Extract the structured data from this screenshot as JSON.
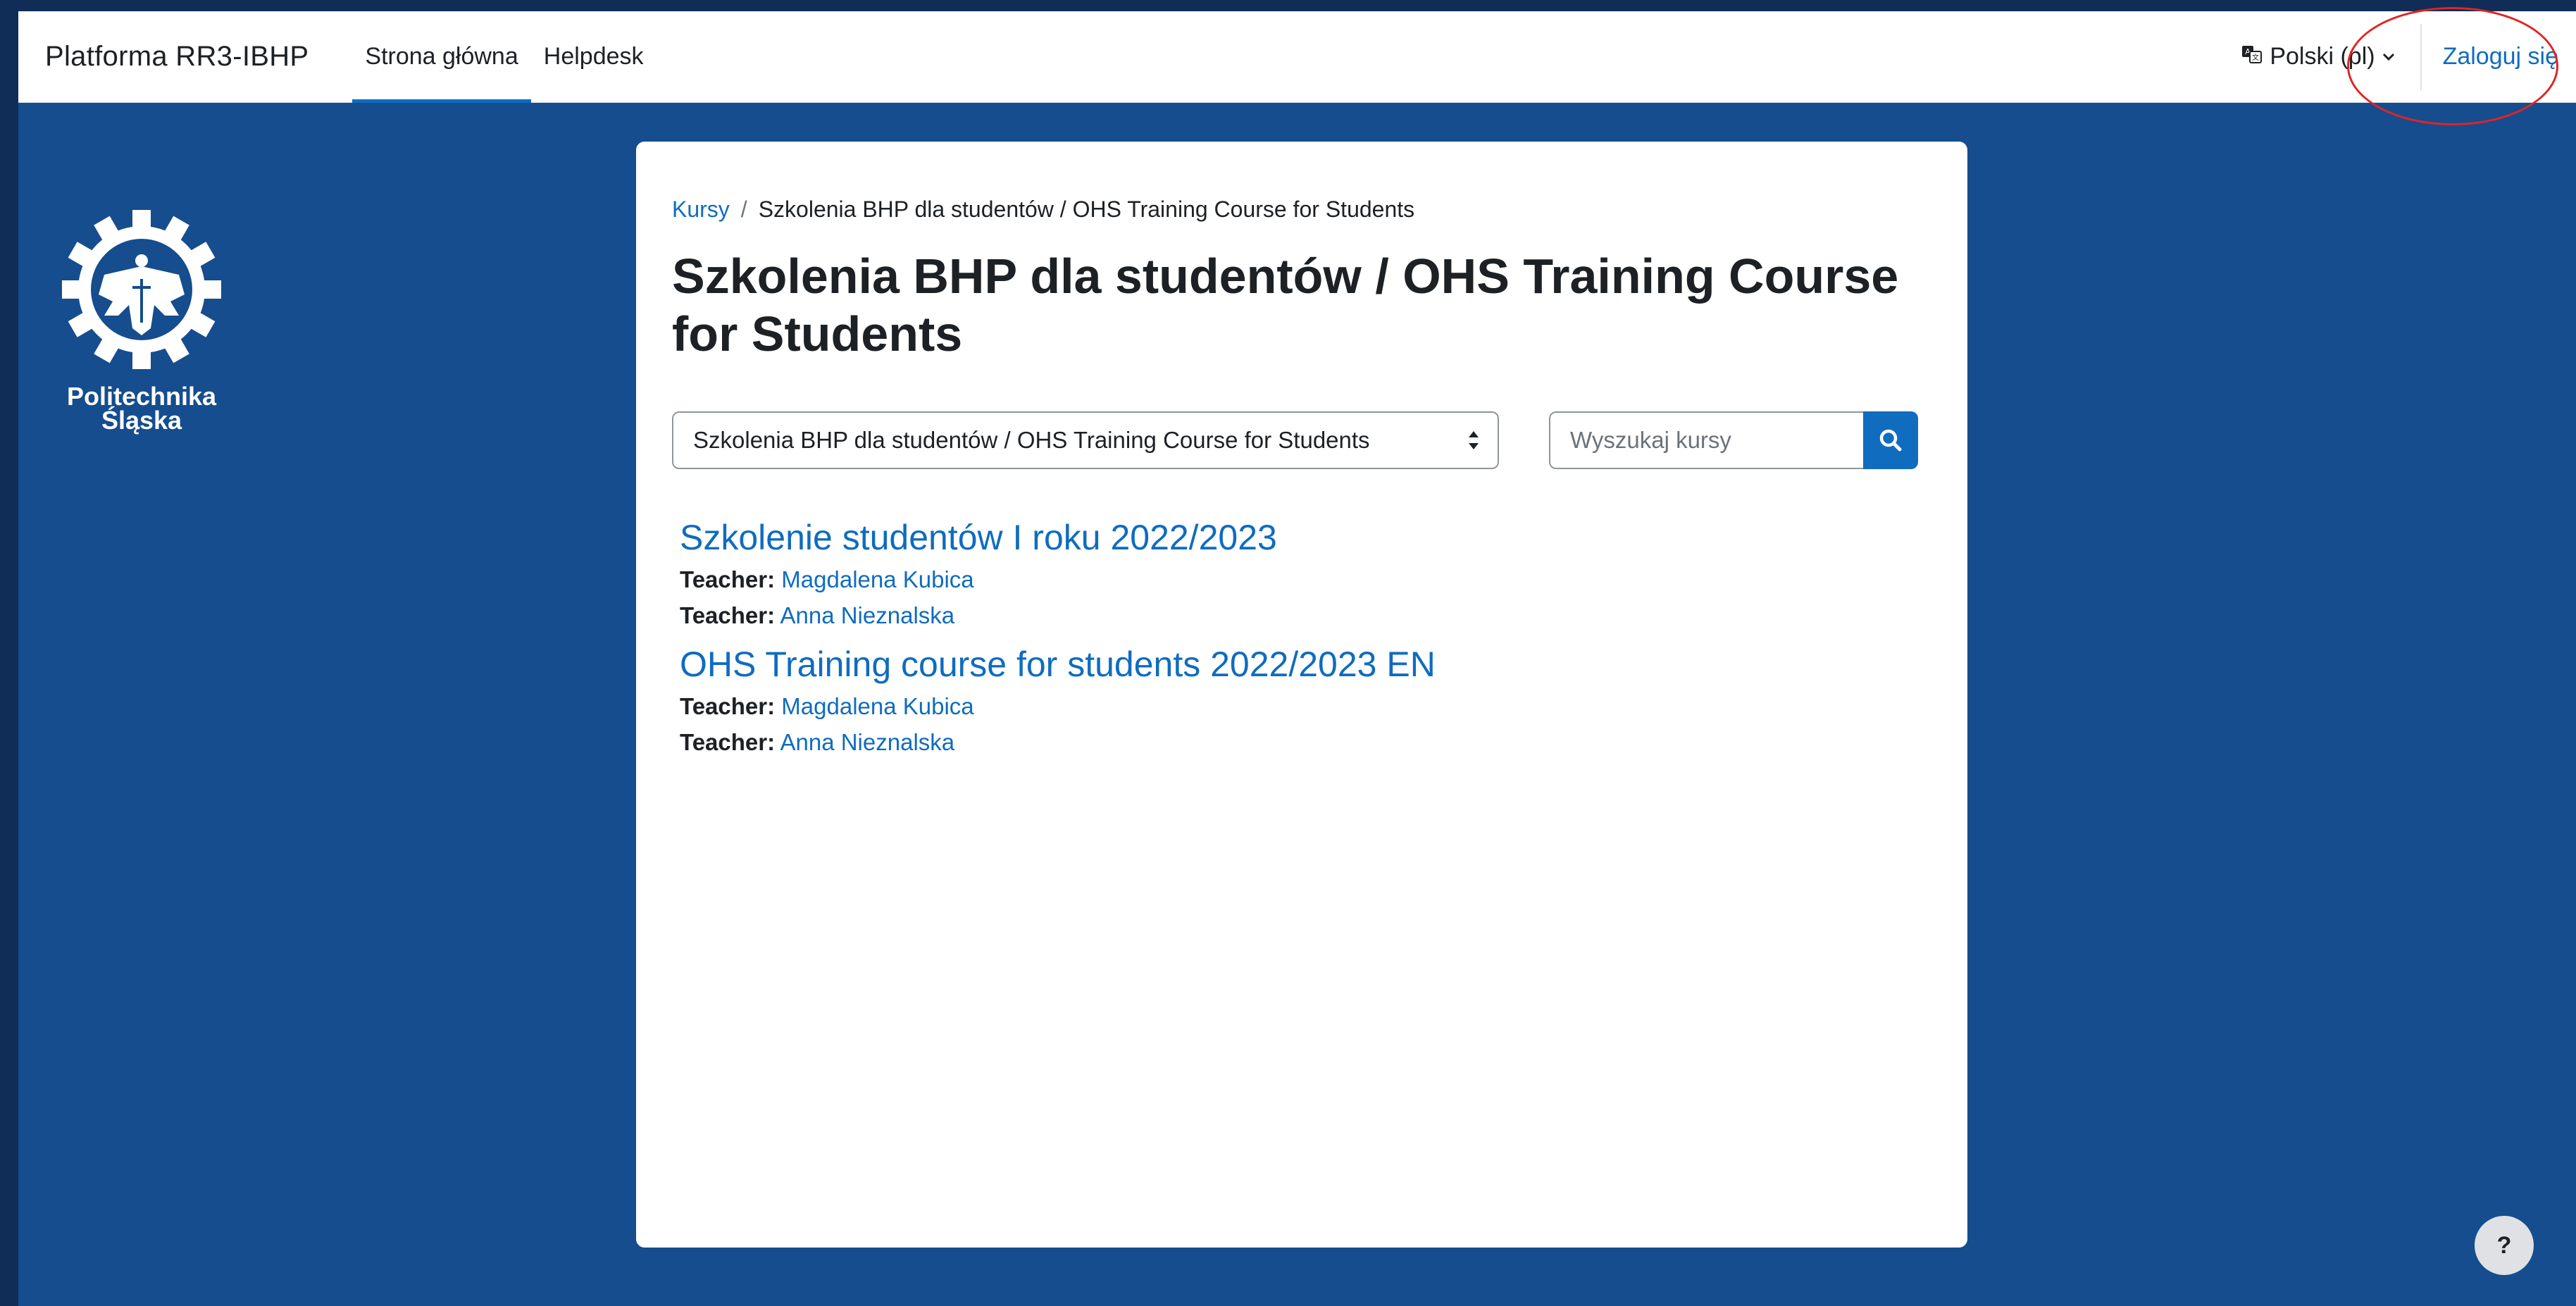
{
  "navbar": {
    "brand": "Platforma RR3-IBHP",
    "links": [
      {
        "label": "Strona główna",
        "active": true
      },
      {
        "label": "Helpdesk",
        "active": false
      }
    ],
    "language": "Polski (pl)",
    "login": "Zaloguj się"
  },
  "logo": {
    "line1": "Politechnika",
    "line2": "Śląska"
  },
  "breadcrumb": {
    "root": "Kursy",
    "current": "Szkolenia BHP dla studentów / OHS Training Course for Students"
  },
  "page_title": "Szkolenia BHP dla studentów / OHS Training Course for Students",
  "category_select": {
    "selected": "Szkolenia BHP dla studentów / OHS Training Course for Students"
  },
  "search": {
    "placeholder": "Wyszukaj kursy",
    "value": ""
  },
  "courses": [
    {
      "name": "Szkolenie studentów I roku 2022/2023",
      "teachers": [
        {
          "label": "Teacher:",
          "name": "Magdalena Kubica"
        },
        {
          "label": "Teacher:",
          "name": "Anna Nieznalska"
        }
      ]
    },
    {
      "name": "OHS Training course for students 2022/2023 EN",
      "teachers": [
        {
          "label": "Teacher:",
          "name": "Magdalena Kubica"
        },
        {
          "label": "Teacher:",
          "name": "Anna Nieznalska"
        }
      ]
    }
  ],
  "help_button": "?",
  "colors": {
    "accent": "#0f6cbf",
    "background": "#154d8e",
    "annotation": "#e02424"
  },
  "icons": {
    "language": "language-icon",
    "search": "search-icon",
    "sort": "sort-icon",
    "help": "question-icon"
  }
}
